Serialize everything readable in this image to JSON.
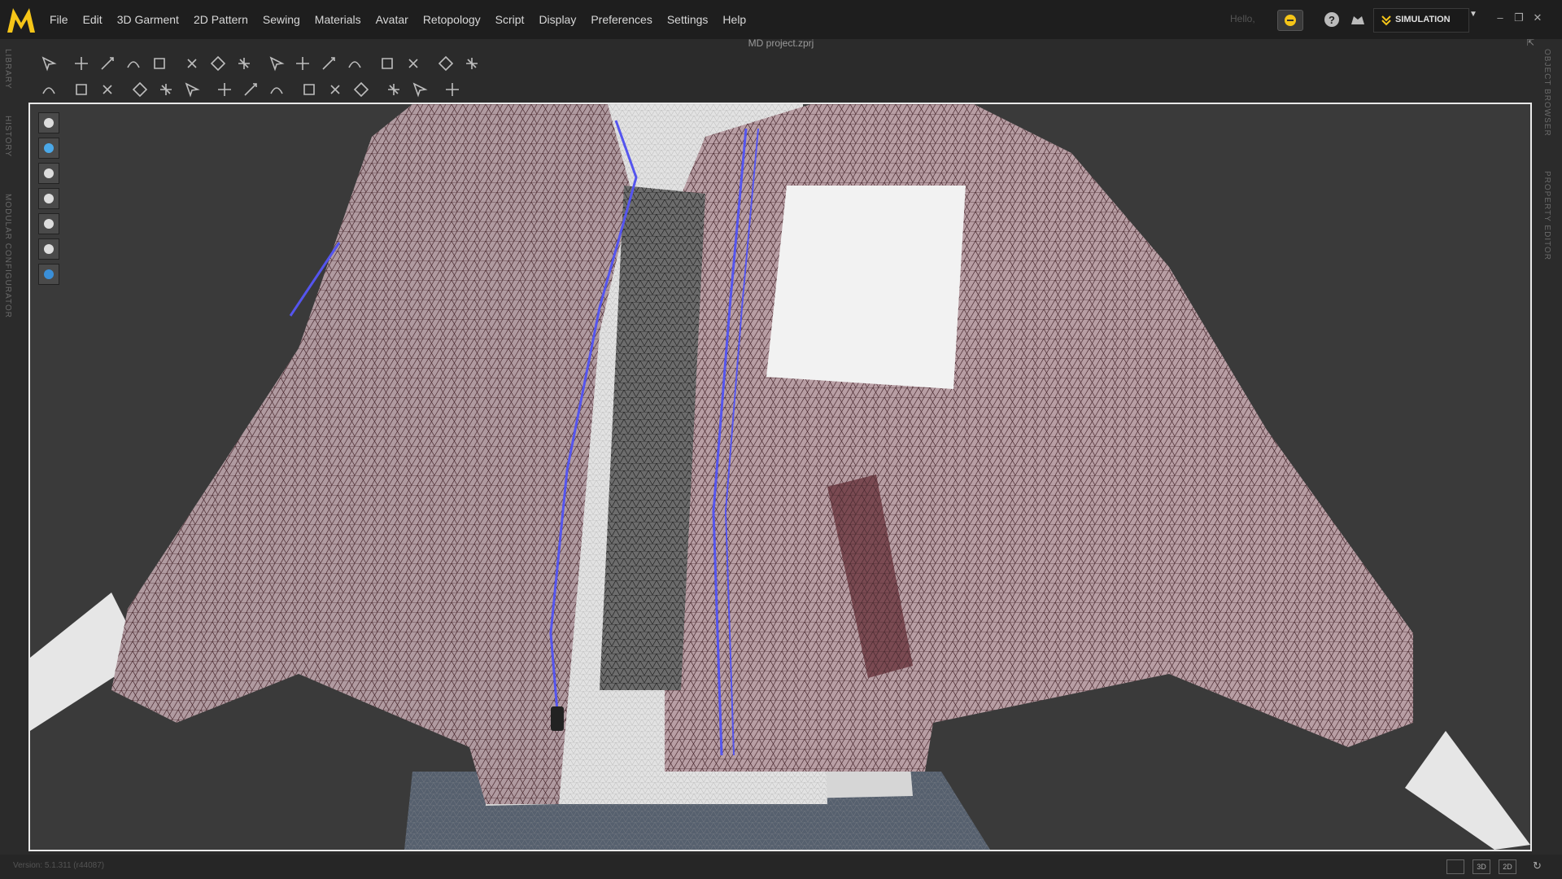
{
  "app": {
    "logo": "MD"
  },
  "menu": [
    "File",
    "Edit",
    "3D Garment",
    "2D Pattern",
    "Sewing",
    "Materials",
    "Avatar",
    "Retopology",
    "Script",
    "Display",
    "Preferences",
    "Settings",
    "Help"
  ],
  "header": {
    "greeting": "Hello,",
    "mode": "SIMULATION",
    "project_title": "MD project.zprj"
  },
  "side_tabs": {
    "left": [
      "LIBRARY",
      "HISTORY",
      "MODULAR CONFIGURATOR"
    ],
    "right": [
      "OBJECT BROWSER",
      "PROPERTY EDITOR"
    ]
  },
  "toolbar1_icons": [
    "avatar-select-icon",
    "transform-pattern-icon",
    "edit-pattern-icon",
    "edit-curvature-icon",
    "fold-arrangement-icon",
    "tack-icon",
    "tack-on-avatar-icon",
    "tack-both-icon",
    "select-sewing-icon",
    "edit-sewing-icon",
    "segment-sewing-icon",
    "free-sewing-icon",
    "arrangement-icon",
    "fit-suit-icon",
    "grid-icon",
    "mesh-icon"
  ],
  "toolbar2_icons": [
    "avatar-pose-icon",
    "select-pin-icon",
    "pin-icon",
    "trace-icon",
    "cut-icon",
    "puckering-icon",
    "button-icon",
    "buttonhole-icon",
    "topstitch-icon",
    "line-icon",
    "zipper-icon",
    "tape-icon",
    "elastic-icon",
    "measure-icon",
    "ruler-icon"
  ],
  "viewport_tools": [
    "garment-view-icon",
    "texture-view-icon",
    "avatar-view-icon",
    "layer-view-icon",
    "fabric-view-icon",
    "avatar-display-icon",
    "environment-icon"
  ],
  "status": {
    "version": "Version: 5.1.311 (r44087)",
    "view_buttons": [
      "",
      "3D",
      "2D"
    ]
  },
  "colors": {
    "accent": "#f5c518",
    "garment_mesh": "#6e3a44",
    "seam_line": "#5555ee",
    "background": "#3a3a3a"
  }
}
